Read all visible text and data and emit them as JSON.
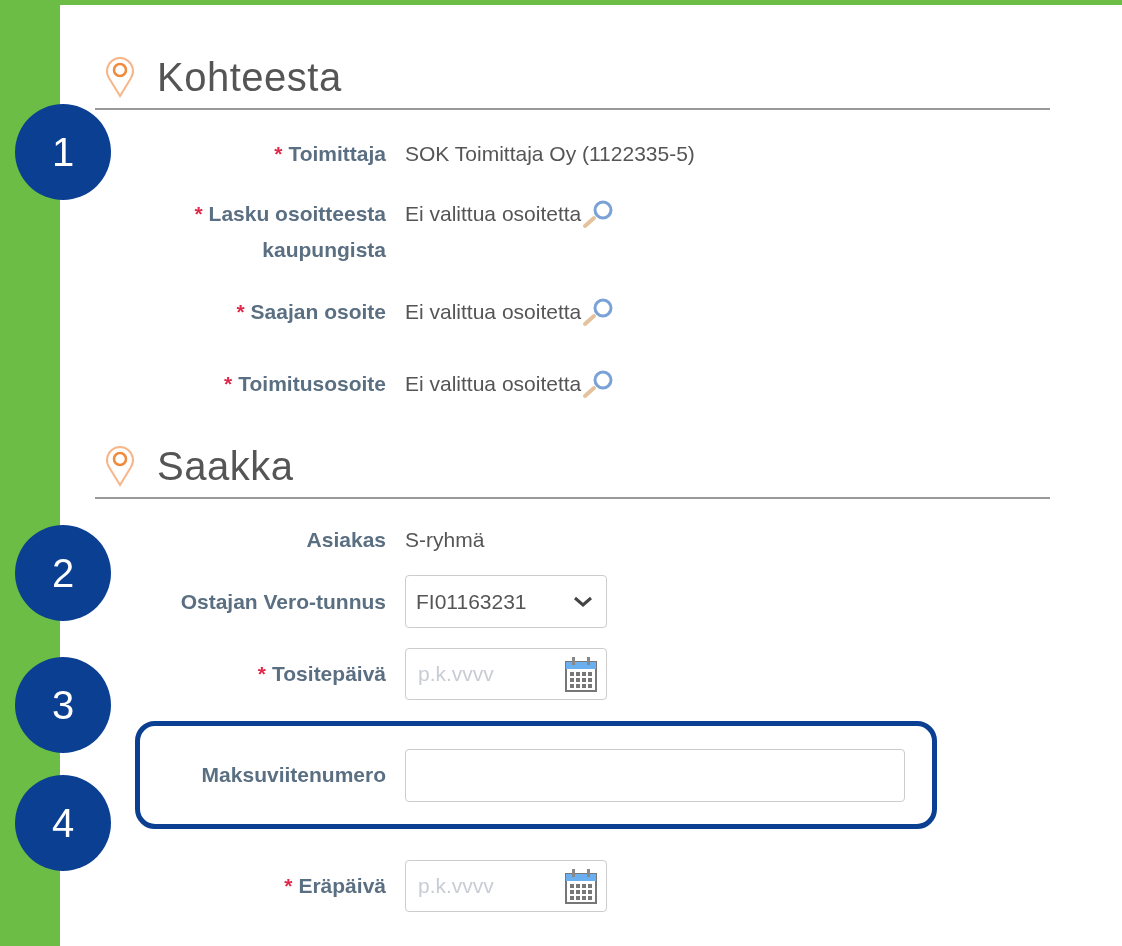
{
  "sections": [
    {
      "title": "Kohteesta",
      "fields": [
        {
          "label": "Toimittaja",
          "required_mark": "*",
          "kind": "text",
          "value": "SOK Toimittaja Oy (1122335-5)"
        },
        {
          "label": "Lasku osoitteesta kaupungista",
          "required_mark": "*",
          "kind": "lookup",
          "value": "Ei valittua osoitetta"
        },
        {
          "label": "Saajan osoite",
          "required_mark": "*",
          "kind": "lookup",
          "value": "Ei valittua osoitetta"
        },
        {
          "label": "Toimitusosoite",
          "required_mark": "*",
          "kind": "lookup",
          "value": "Ei valittua osoitetta"
        }
      ]
    },
    {
      "title": "Saakka",
      "fields": [
        {
          "label": "Asiakas",
          "kind": "text",
          "value": "S-ryhmä"
        },
        {
          "label": "Ostajan Vero-tunnus",
          "kind": "select",
          "value": "FI01163231"
        },
        {
          "label": "Tositepäivä",
          "required_mark": "*",
          "kind": "date",
          "placeholder": "p.k.vvvv"
        },
        {
          "label": "Maksuviitenumero",
          "kind": "input",
          "highlighted": true
        },
        {
          "label": "Eräpäivä",
          "required_mark": "*",
          "kind": "date",
          "placeholder": "p.k.vvvv"
        }
      ]
    }
  ],
  "callouts": [
    "1",
    "2",
    "3",
    "4"
  ]
}
